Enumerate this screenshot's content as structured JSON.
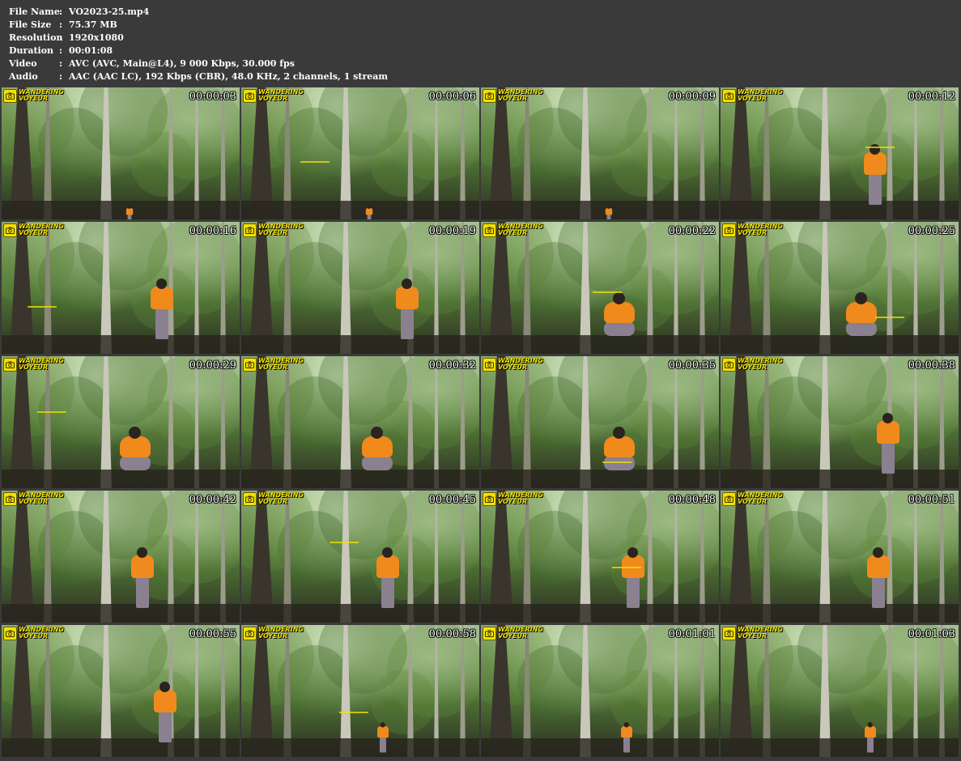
{
  "info": [
    {
      "label": "File Name",
      "sep": ":",
      "value": "VO2023-25.mp4"
    },
    {
      "label": "File Size",
      "sep": ":",
      "value": "75.37 MB"
    },
    {
      "label": "Resolution",
      "sep": ":",
      "value": "1920x1080"
    },
    {
      "label": "Duration",
      "sep": ":",
      "value": "00:01:08"
    },
    {
      "label": "Video",
      "sep": ":",
      "value": "AVC (AVC, Main@L4), 9 000 Kbps, 30.000 fps"
    },
    {
      "label": "Audio",
      "sep": ":",
      "value": "AAC (AAC LC), 192 Kbps (CBR), 48.0 KHz, 2 channels, 1 stream"
    }
  ],
  "logo": {
    "line1": "WANDERING",
    "line2": "VOYEUR"
  },
  "colors": {
    "background": "#3a3a3a",
    "logo": "#f2e100",
    "jacket": "#f08a1c"
  },
  "thumbnails": [
    {
      "time": "00:00:03",
      "figure": "tiny",
      "watermark": false
    },
    {
      "time": "00:00:06",
      "figure": "tiny",
      "watermark": true
    },
    {
      "time": "00:00:09",
      "figure": "tiny",
      "watermark": false
    },
    {
      "time": "00:00:12",
      "figure": "standing",
      "watermark": true
    },
    {
      "time": "00:00:16",
      "figure": "standing",
      "watermark": true
    },
    {
      "time": "00:00:19",
      "figure": "standing",
      "watermark": false
    },
    {
      "time": "00:00:22",
      "figure": "squat",
      "watermark": true
    },
    {
      "time": "00:00:25",
      "figure": "squat",
      "watermark": true
    },
    {
      "time": "00:00:29",
      "figure": "squat",
      "watermark": true
    },
    {
      "time": "00:00:32",
      "figure": "squat",
      "watermark": false
    },
    {
      "time": "00:00:35",
      "figure": "squat",
      "watermark": true
    },
    {
      "time": "00:00:38",
      "figure": "standing",
      "watermark": false
    },
    {
      "time": "00:00:42",
      "figure": "standing",
      "watermark": false
    },
    {
      "time": "00:00:45",
      "figure": "standing",
      "watermark": true
    },
    {
      "time": "00:00:48",
      "figure": "standing",
      "watermark": true
    },
    {
      "time": "00:00:51",
      "figure": "standing",
      "watermark": false
    },
    {
      "time": "00:00:55",
      "figure": "standing",
      "watermark": false
    },
    {
      "time": "00:00:58",
      "figure": "small",
      "watermark": true
    },
    {
      "time": "00:01:01",
      "figure": "small",
      "watermark": false
    },
    {
      "time": "00:01:03",
      "figure": "small",
      "watermark": false
    }
  ]
}
